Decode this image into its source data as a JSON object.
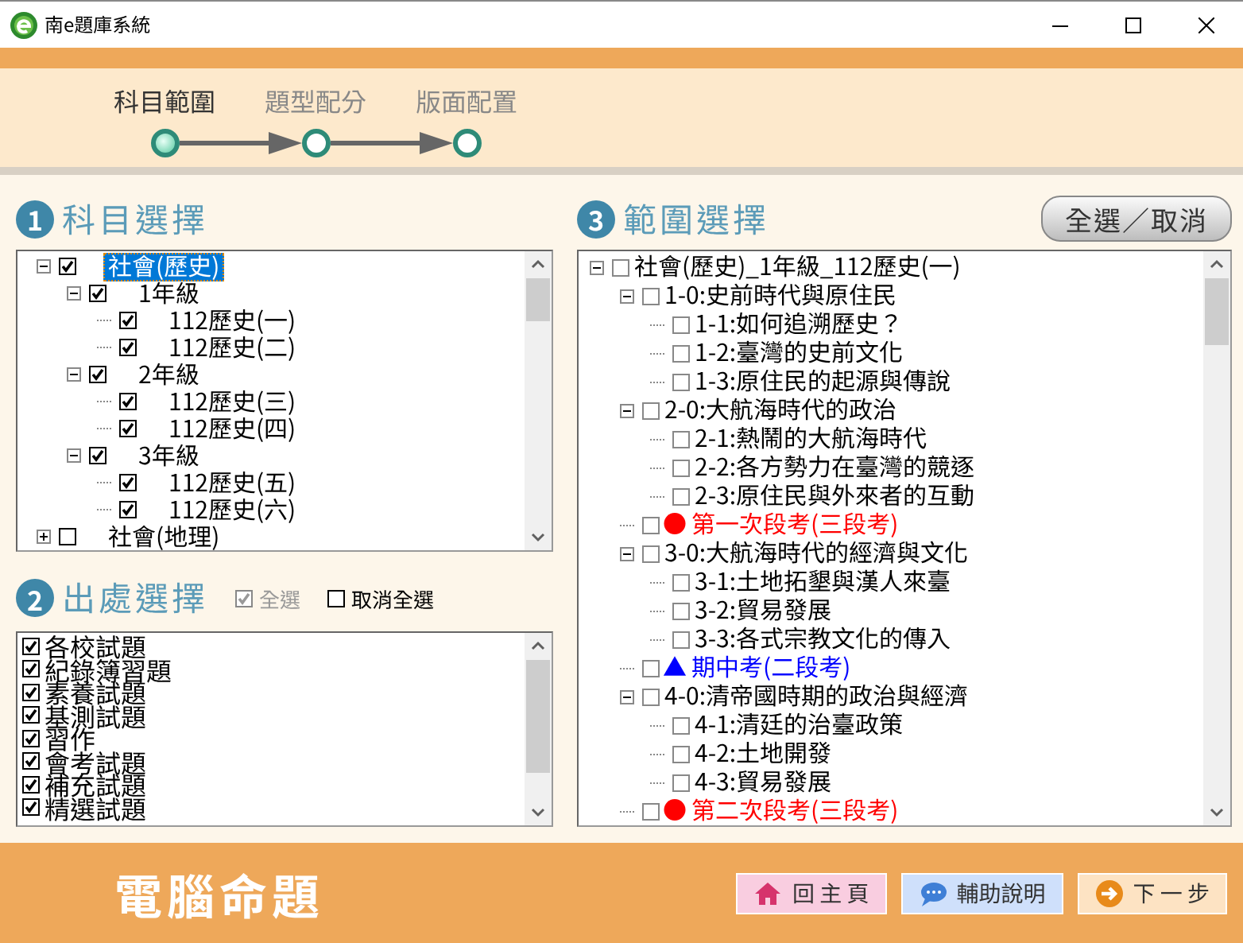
{
  "window": {
    "title": "南e題庫系統"
  },
  "steps": [
    {
      "label": "科目範圍",
      "selected": true
    },
    {
      "label": "題型配分",
      "selected": false
    },
    {
      "label": "版面配置",
      "selected": false
    }
  ],
  "subject_panel": {
    "number": "1",
    "title": "科目選擇",
    "tree": [
      {
        "label": "社會(歷史)",
        "checked": true,
        "selected": true,
        "expanded": true,
        "children": [
          {
            "label": "1年級",
            "checked": true,
            "selected": false,
            "expanded": true,
            "children": [
              {
                "label": "112歷史(一)",
                "checked": true,
                "selected": false
              },
              {
                "label": "112歷史(二)",
                "checked": true,
                "selected": false
              }
            ]
          },
          {
            "label": "2年級",
            "checked": true,
            "selected": false,
            "expanded": true,
            "children": [
              {
                "label": "112歷史(三)",
                "checked": true,
                "selected": false
              },
              {
                "label": "112歷史(四)",
                "checked": true,
                "selected": false
              }
            ]
          },
          {
            "label": "3年級",
            "checked": true,
            "selected": false,
            "expanded": true,
            "children": [
              {
                "label": "112歷史(五)",
                "checked": true,
                "selected": false
              },
              {
                "label": "112歷史(六)",
                "checked": true,
                "selected": false
              }
            ]
          }
        ]
      },
      {
        "label": "社會(地理)",
        "checked": false,
        "selected": false,
        "expanded": false
      }
    ]
  },
  "source_panel": {
    "number": "2",
    "title": "出處選擇",
    "select_all": {
      "label": "全選",
      "checked": true,
      "disabled": true
    },
    "deselect_all": {
      "label": "取消全選",
      "checked": false,
      "disabled": false
    },
    "items": [
      {
        "label": "各校試題",
        "checked": true
      },
      {
        "label": "紀錄簿習題",
        "checked": true
      },
      {
        "label": "素養試題",
        "checked": true
      },
      {
        "label": "基測試題",
        "checked": true
      },
      {
        "label": "習作",
        "checked": true
      },
      {
        "label": "會考試題",
        "checked": true
      },
      {
        "label": "補充試題",
        "checked": true
      },
      {
        "label": "精選試題",
        "checked": true
      }
    ]
  },
  "range_panel": {
    "number": "3",
    "title": "範圍選擇",
    "toggle_button": "全選／取消",
    "tree": [
      {
        "kind": "unit",
        "label": "社會(歷史)_1年級_112歷史(一)",
        "checked": false,
        "expanded": true,
        "children": [
          {
            "kind": "unit",
            "label": "1-0:史前時代與原住民",
            "checked": false,
            "expanded": true,
            "children": [
              {
                "kind": "unit",
                "label": "1-1:如何追溯歷史？",
                "checked": false
              },
              {
                "kind": "unit",
                "label": "1-2:臺灣的史前文化",
                "checked": false
              },
              {
                "kind": "unit",
                "label": "1-3:原住民的起源與傳說",
                "checked": false
              }
            ]
          },
          {
            "kind": "unit",
            "label": "2-0:大航海時代的政治",
            "checked": false,
            "expanded": true,
            "children": [
              {
                "kind": "unit",
                "label": "2-1:熱鬧的大航海時代",
                "checked": false
              },
              {
                "kind": "unit",
                "label": "2-2:各方勢力在臺灣的競逐",
                "checked": false
              },
              {
                "kind": "unit",
                "label": "2-3:原住民與外來者的互動",
                "checked": false
              }
            ]
          },
          {
            "kind": "exam",
            "marker": "●",
            "color": "#ff0000",
            "label": "第一次段考(三段考)",
            "checked": false
          },
          {
            "kind": "unit",
            "label": "3-0:大航海時代的經濟與文化",
            "checked": false,
            "expanded": true,
            "children": [
              {
                "kind": "unit",
                "label": "3-1:土地拓墾與漢人來臺",
                "checked": false
              },
              {
                "kind": "unit",
                "label": "3-2:貿易發展",
                "checked": false
              },
              {
                "kind": "unit",
                "label": "3-3:各式宗教文化的傳入",
                "checked": false
              }
            ]
          },
          {
            "kind": "exam",
            "marker": "▲",
            "color": "#0000ff",
            "label": "期中考(二段考)",
            "checked": false
          },
          {
            "kind": "unit",
            "label": "4-0:清帝國時期的政治與經濟",
            "checked": false,
            "expanded": true,
            "children": [
              {
                "kind": "unit",
                "label": "4-1:清廷的治臺政策",
                "checked": false
              },
              {
                "kind": "unit",
                "label": "4-2:土地開發",
                "checked": false
              },
              {
                "kind": "unit",
                "label": "4-3:貿易發展",
                "checked": false
              }
            ]
          },
          {
            "kind": "exam",
            "marker": "●",
            "color": "#ff0000",
            "label": "第二次段考(三段考)",
            "checked": false
          }
        ]
      }
    ]
  },
  "footer": {
    "title": "電腦命題",
    "buttons": [
      {
        "kind": "home",
        "label": "回 主 頁"
      },
      {
        "kind": "help",
        "label": "輔助說明"
      },
      {
        "kind": "next",
        "label": "下 一 步"
      }
    ]
  }
}
